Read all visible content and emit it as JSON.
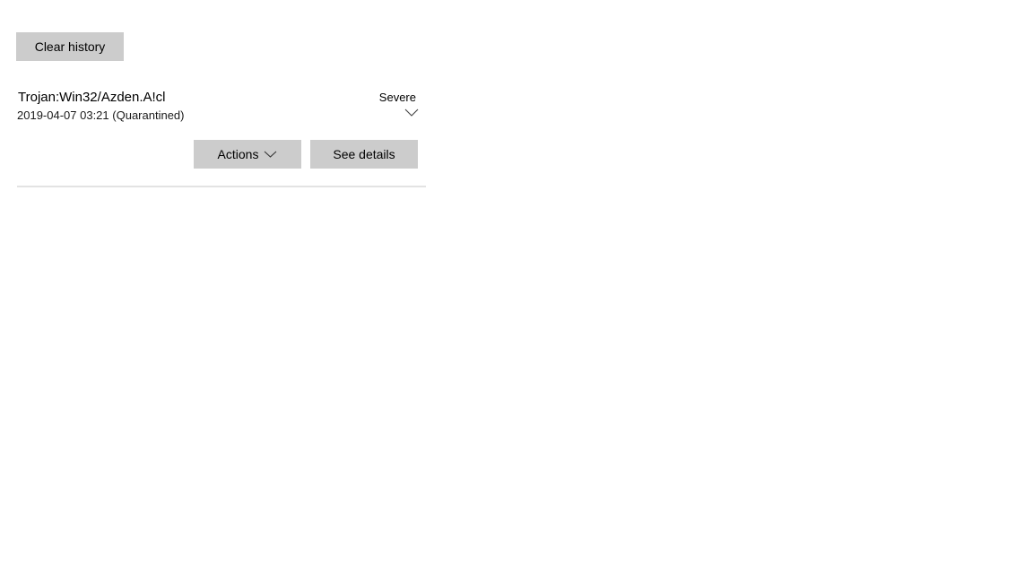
{
  "toolbar": {
    "clear_history_label": "Clear history"
  },
  "threat": {
    "name": "Trojan:Win32/Azden.A!cl",
    "date": "2019-04-07 03:21",
    "status": "(Quarantined)",
    "severity": "Severe",
    "expand_icon": "chevron-down-icon",
    "actions_label": "Actions",
    "actions_icon": "chevron-down-icon",
    "details_label": "See details"
  },
  "colors": {
    "button_bg": "#cccccc",
    "divider": "#e3e3e3",
    "text": "#000000"
  }
}
